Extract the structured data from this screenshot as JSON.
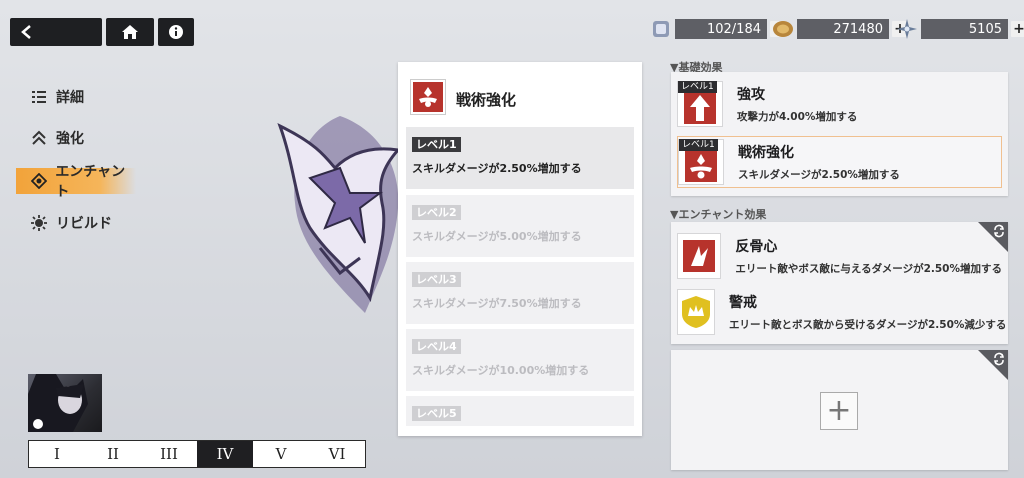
{
  "topbar": {
    "back_icon": "back-arrow-icon",
    "home_icon": "home-icon",
    "info_icon": "info-icon",
    "resources": [
      {
        "icon": "stamina-icon",
        "value": "102/184"
      },
      {
        "icon": "coin-icon",
        "value": "271480"
      },
      {
        "icon": "crystal-icon",
        "value": "5105"
      }
    ]
  },
  "nav": {
    "items": [
      {
        "label": "詳細",
        "icon": "details-icon"
      },
      {
        "label": "強化",
        "icon": "upgrade-icon"
      },
      {
        "label": "エンチャント",
        "icon": "enchant-icon",
        "active": true
      },
      {
        "label": "リビルド",
        "icon": "rebuild-icon"
      }
    ]
  },
  "skill_panel": {
    "title": "戦術強化",
    "levels": [
      {
        "tag": "レベル1",
        "desc": "スキルダメージが2.50%増加する",
        "unlocked": true
      },
      {
        "tag": "レベル2",
        "desc": "スキルダメージが5.00%増加する",
        "unlocked": false
      },
      {
        "tag": "レベル3",
        "desc": "スキルダメージが7.50%増加する",
        "unlocked": false
      },
      {
        "tag": "レベル4",
        "desc": "スキルダメージが10.00%増加する",
        "unlocked": false
      },
      {
        "tag": "レベル5",
        "desc": "",
        "unlocked": false
      }
    ]
  },
  "base_effects": {
    "header": "▼基礎効果",
    "items": [
      {
        "tag": "レベル1",
        "title": "強攻",
        "desc": "攻撃力が4.00%増加する"
      },
      {
        "tag": "レベル1",
        "title": "戦術強化",
        "desc": "スキルダメージが2.50%増加する",
        "selected": true
      }
    ]
  },
  "enchant_effects": {
    "header": "▼エンチャント効果",
    "items": [
      {
        "title": "反骨心",
        "desc": "エリート敵やボス敵に与えるダメージが2.50%増加する"
      },
      {
        "title": "警戒",
        "desc": "エリート敵とボス敵から受けるダメージが2.50%減少する"
      }
    ],
    "add_label": "+"
  },
  "tiers": {
    "items": [
      "I",
      "II",
      "III",
      "IV",
      "V",
      "VI"
    ],
    "selected": "IV"
  },
  "colors": {
    "accent": "#f2a33a",
    "skill_red": "#b7332c",
    "shield_gold": "#e0c020",
    "dark": "#1e1f22"
  }
}
